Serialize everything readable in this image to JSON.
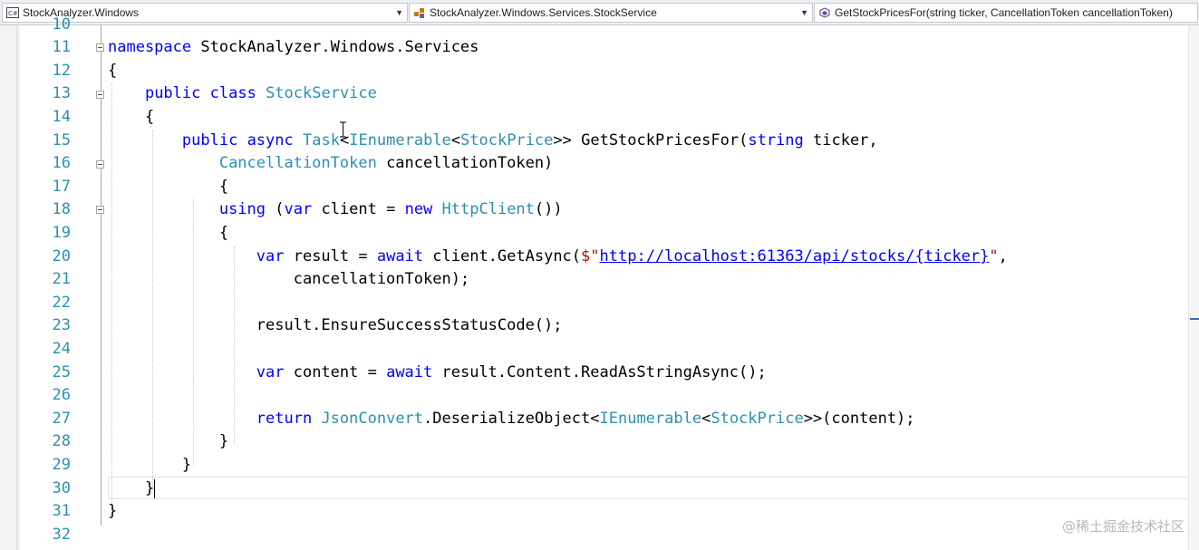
{
  "navigation": {
    "project_combo": {
      "icon": "csharp-project-icon",
      "label": "StockAnalyzer.Windows"
    },
    "type_combo": {
      "icon": "class-icon",
      "label": "StockAnalyzer.Windows.Services.StockService"
    },
    "member_combo": {
      "icon": "method-icon",
      "label": "GetStockPricesFor(string ticker, CancellationToken cancellationToken)"
    },
    "dropdown_arrow": "▼"
  },
  "editor": {
    "line_numbers": [
      "10",
      "11",
      "12",
      "13",
      "14",
      "15",
      "16",
      "17",
      "18",
      "19",
      "20",
      "21",
      "22",
      "23",
      "24",
      "25",
      "26",
      "27",
      "28",
      "29",
      "30",
      "31",
      "32"
    ],
    "lines": {
      "l11": {
        "kw_namespace": "namespace",
        "rest": " StockAnalyzer.Windows.Services"
      },
      "l12": {
        "text": "{"
      },
      "l13": {
        "kw_public": "public",
        "kw_class": "class",
        "type": "StockService"
      },
      "l14": {
        "text": "{"
      },
      "l15": {
        "kw_public": "public",
        "kw_async": "async",
        "t_task": "Task",
        "p1": "<",
        "t_ienum": "IEnumerable",
        "p2": "<",
        "t_sp": "StockPrice",
        "p3": ">> GetStockPricesFor(",
        "kw_string": "string",
        "p4": " ticker,"
      },
      "l16": {
        "t_ct": "CancellationToken",
        "rest": " cancellationToken)"
      },
      "l17": {
        "text": "{"
      },
      "l18": {
        "kw_using": "using",
        "p1": " (",
        "kw_var": "var",
        "p2": " client = ",
        "kw_new": "new",
        "t_http": "HttpClient",
        "p3": "())"
      },
      "l19": {
        "text": "{"
      },
      "l20": {
        "kw_var": "var",
        "p1": " result = ",
        "kw_await": "await",
        "p2": " client.GetAsync(",
        "s_open": "$\"",
        "url": "http://localhost:61363/api/stocks/{ticker}",
        "s_close": "\"",
        "p3": ","
      },
      "l21": {
        "text": "cancellationToken);"
      },
      "l23": {
        "text": "result.EnsureSuccessStatusCode();"
      },
      "l25": {
        "kw_var": "var",
        "p1": " content = ",
        "kw_await": "await",
        "p2": " result.Content.ReadAsStringAsync();"
      },
      "l27": {
        "kw_return": "return",
        "t_json": "JsonConvert",
        "p1": ".DeserializeObject<",
        "t_ienum": "IEnumerable",
        "p2": "<",
        "t_sp": "StockPrice",
        "p3": ">>(content);"
      },
      "l28": {
        "text": "}"
      },
      "l29": {
        "text": "}"
      },
      "l30": {
        "text": "}"
      },
      "l31": {
        "text": "}"
      }
    }
  },
  "watermark": "@稀土掘金技术社区",
  "colors": {
    "keyword": "#0000ff",
    "type": "#2b91af",
    "line_number": "#2b91af",
    "string": "#a31515"
  }
}
